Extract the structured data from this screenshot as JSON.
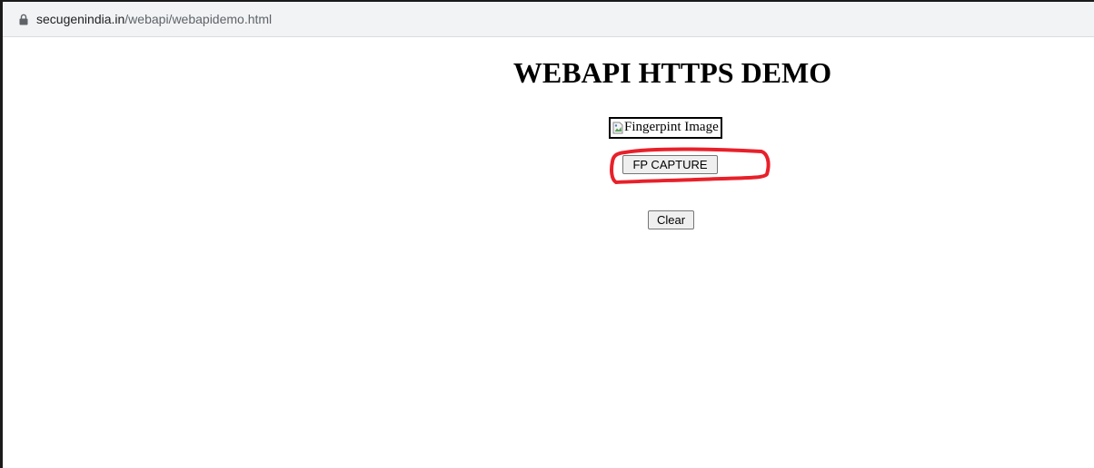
{
  "browser": {
    "url_domain": "secugenindia.in",
    "url_path": "/webapi/webapidemo.html"
  },
  "page": {
    "title": "WEBAPI HTTPS DEMO",
    "fingerprint_alt": "Fingerpint Image",
    "capture_button": "FP CAPTURE",
    "clear_button": "Clear"
  },
  "annotation": {
    "color": "#e8202a"
  },
  "icons": [
    "lock-icon",
    "broken-image-icon"
  ]
}
